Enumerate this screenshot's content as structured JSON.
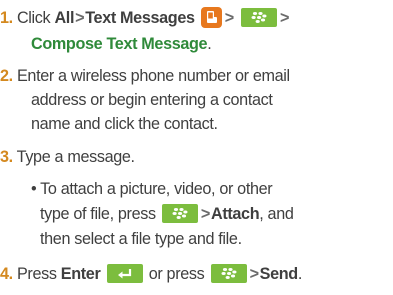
{
  "steps": [
    {
      "number": "1.",
      "click": "Click",
      "all": "All",
      "text_messages": "Text Messages",
      "compose": "Compose Text Message",
      "period": "."
    },
    {
      "number": "2.",
      "line1": "Enter a wireless phone number or email",
      "line2": "address or begin entering a contact",
      "line3": "name and click the contact."
    },
    {
      "number": "3.",
      "text": "Type a message.",
      "bullet": {
        "line1": "• To attach a picture, video, or other",
        "line2": "type of file, press",
        "attach": "Attach",
        "line2_end": ", and",
        "line3": "then select a file type and file."
      }
    },
    {
      "number": "4.",
      "press": "Press",
      "enter": "Enter",
      "or_press": "or press",
      "send": "Send",
      "period": "."
    }
  ],
  "separator": ">",
  "icons": {
    "blackberry_key": "blackberry-menu-key-icon",
    "enter_key": "enter-key-icon",
    "messages_app": "text-messages-app-icon"
  },
  "colors": {
    "step_number": "#d4891f",
    "emphasis": "#2f8a3a",
    "key_fill": "#7cbd3e",
    "app_icon": "#e7781e",
    "body_text": "#3f3f3f"
  }
}
